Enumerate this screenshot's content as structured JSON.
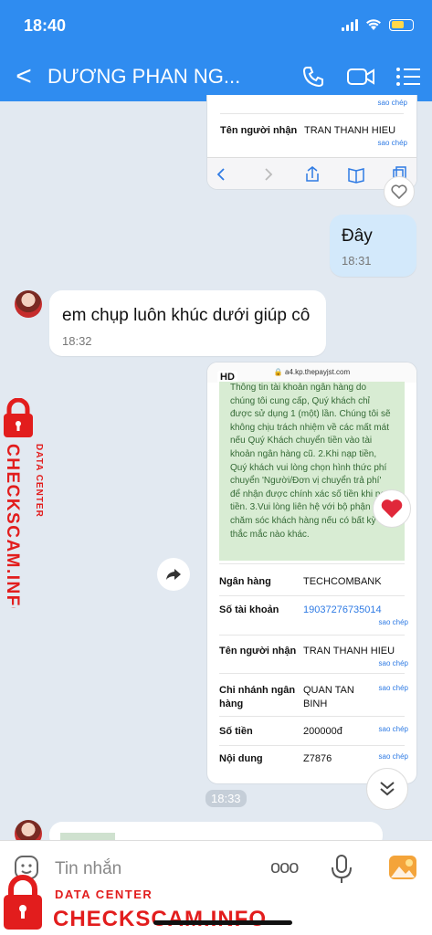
{
  "status": {
    "time": "18:40"
  },
  "header": {
    "back": "<",
    "title": "DƯƠNG PHAN NG..."
  },
  "top_card": {
    "copy1": "sao chép",
    "recipient_label": "Tên người nhận",
    "recipient_value": "TRAN THANH HIEU",
    "copy2": "sao chép"
  },
  "msg_out": {
    "text": "Đây",
    "time": "18:31"
  },
  "msg_in": {
    "text": "em chụp luôn khúc dưới giúp cô",
    "time": "18:32"
  },
  "screenshot": {
    "hd": "HD",
    "url": "a4.kp.thepayjst.com",
    "note": "Thông tin tài khoản ngân hàng do chúng tôi cung cấp, Quý khách chỉ được sử dụng 1 (một) lần. Chúng tôi sẽ không chịu trách nhiệm về các mất mát nếu Quý Khách chuyển tiền vào tài khoản ngân hàng cũ. 2.Khi nạp tiền, Quý khách vui lòng chọn hình thức phí chuyển 'Người/Đơn vị chuyển trả phí' để nhận được chính xác số tiền khi nạp tiền. 3.Vui lòng liên hệ với bộ phận chăm sóc khách hàng nếu có bất kỳ thắc mắc nào khác.",
    "rows": [
      {
        "label": "Ngân hàng",
        "value": "TECHCOMBANK",
        "copy": ""
      },
      {
        "label": "Số tài khoản",
        "value": "19037276735014",
        "copy": "sao chép"
      },
      {
        "label": "Tên người nhận",
        "value": "TRAN THANH HIEU",
        "copy": "sao chép"
      },
      {
        "label": "Chi nhánh ngân hàng",
        "value": "QUAN TAN BINH",
        "copy": "sao chép"
      },
      {
        "label": "Số tiền",
        "value": "200000đ",
        "copy": "sao chép"
      },
      {
        "label": "Nội dung",
        "value": "Z7876",
        "copy": "sao chép"
      }
    ],
    "time": "18:33"
  },
  "input": {
    "placeholder": "Tin nhắn",
    "more": "ooo"
  },
  "watermark": {
    "line1": "DATA CENTER",
    "line2": "CHECKSCAM.INFO"
  },
  "colors": {
    "header": "#2f8cf0",
    "watermark": "#e21d1d",
    "outgoing_bubble": "#d3e9fb",
    "link": "#2f7be4"
  }
}
